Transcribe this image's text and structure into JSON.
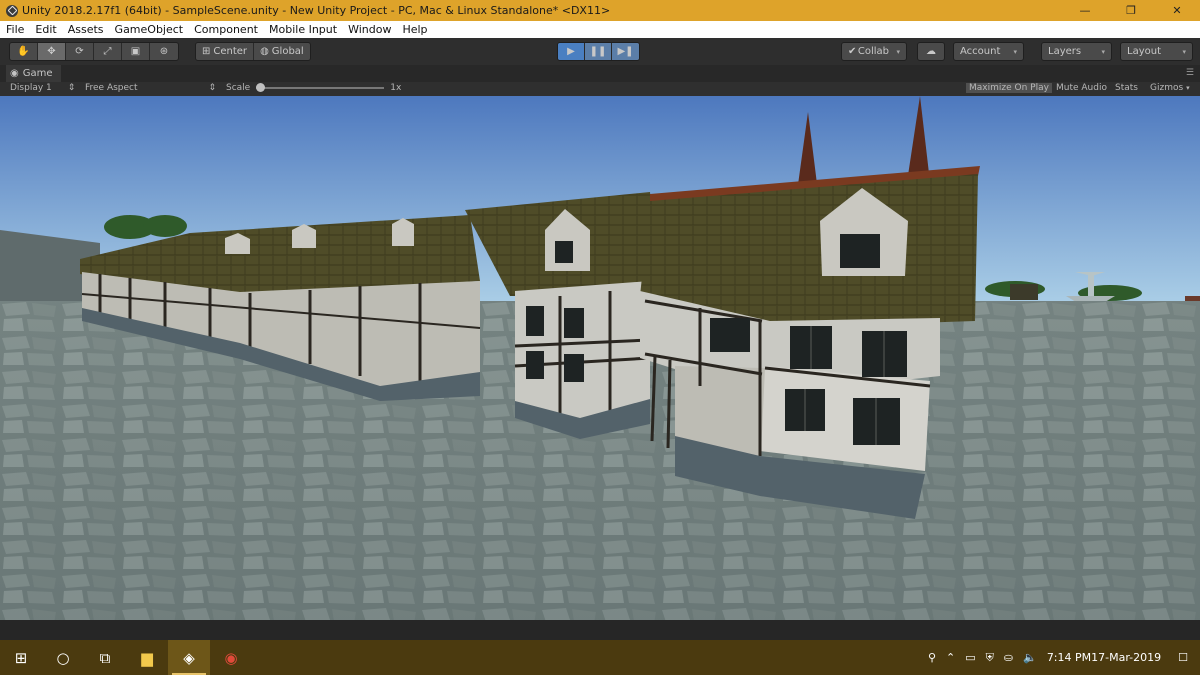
{
  "window": {
    "title": "Unity 2018.2.17f1 (64bit) - SampleScene.unity - New Unity Project - PC, Mac & Linux Standalone* <DX11>",
    "minimize_glyph": "—",
    "restore_glyph": "❐",
    "close_glyph": "✕"
  },
  "menu": {
    "items": [
      "File",
      "Edit",
      "Assets",
      "GameObject",
      "Component",
      "Mobile Input",
      "Window",
      "Help"
    ]
  },
  "toolbar": {
    "tools": [
      {
        "name": "hand-tool",
        "icon": "hand-icon",
        "glyph": "✋"
      },
      {
        "name": "move-tool",
        "icon": "move-icon",
        "glyph": "✥"
      },
      {
        "name": "rotate-tool",
        "icon": "rotate-icon",
        "glyph": "⟳"
      },
      {
        "name": "scale-tool",
        "icon": "scale-icon",
        "glyph": "⤢"
      },
      {
        "name": "rect-tool",
        "icon": "rect-icon",
        "glyph": "▣"
      },
      {
        "name": "transform-tool",
        "icon": "transform-icon",
        "glyph": "⊛"
      }
    ],
    "pivot_label": "Center",
    "rotation_label": "Global",
    "play_glyph": "▶",
    "pause_glyph": "❚❚",
    "step_glyph": "▶❚",
    "collab_label": "Collab",
    "account_label": "Account",
    "layers_label": "Layers",
    "layout_label": "Layout",
    "caret": "▾"
  },
  "game_view": {
    "tab_label": "Game",
    "display_label": "Display 1",
    "aspect_label": "Free Aspect",
    "scale_label": "Scale",
    "scale_value": "1x",
    "maximize_label": "Maximize On Play",
    "mute_label": "Mute Audio",
    "stats_label": "Stats",
    "gizmos_label": "Gizmos",
    "colors": {
      "sky_top": "#4d78be",
      "sky_bottom": "#a9cde6",
      "ground": "#6e7c7b",
      "roof": "#4d4a26",
      "roof_trim": "#7a3a20",
      "wall": "#c9c9c3",
      "timber": "#2a2620",
      "stone_base": "#53626a"
    }
  },
  "taskbar": {
    "time": "7:14 PM",
    "date": "17-Mar-2019",
    "items": [
      {
        "name": "start-button",
        "icon": "windows-icon"
      },
      {
        "name": "cortana-button",
        "icon": "search-circle-icon"
      },
      {
        "name": "task-view-button",
        "icon": "task-view-icon"
      },
      {
        "name": "file-explorer-button",
        "icon": "folder-icon"
      },
      {
        "name": "unity-taskbar-button",
        "icon": "unity-icon"
      },
      {
        "name": "chrome-taskbar-button",
        "icon": "chrome-icon"
      }
    ]
  }
}
